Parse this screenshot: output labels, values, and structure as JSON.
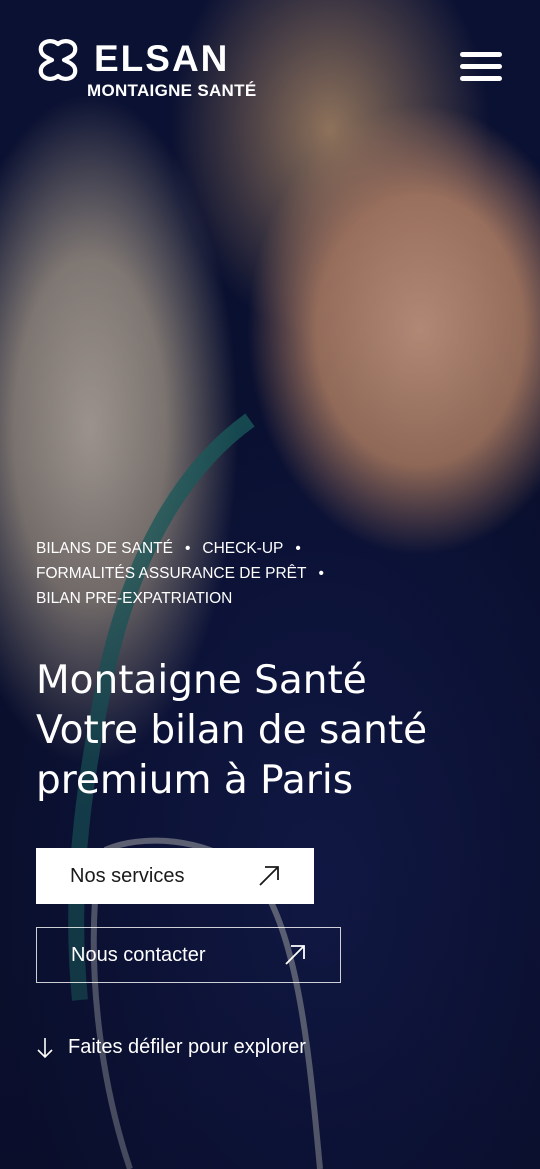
{
  "brand": {
    "name": "ELSAN",
    "subtitle": "MONTAIGNE SANTÉ",
    "logo_icon": "elsan-logo-icon"
  },
  "menu": {
    "icon": "hamburger-menu-icon"
  },
  "hero": {
    "tags": [
      "BILANS DE SANTÉ",
      "CHECK-UP",
      "FORMALITÉS ASSURANCE DE PRÊT",
      "BILAN PRE-EXPATRIATION"
    ],
    "separator": "•",
    "title_lines": [
      "Montaigne Santé",
      "Votre bilan de santé",
      "premium à Paris"
    ],
    "primary_button": "Nos services",
    "secondary_button": "Nous contacter",
    "scroll_hint": "Faites défiler pour explorer"
  },
  "colors": {
    "text": "#ffffff",
    "button_bg": "#ffffff",
    "button_text": "#1a1a1a"
  }
}
